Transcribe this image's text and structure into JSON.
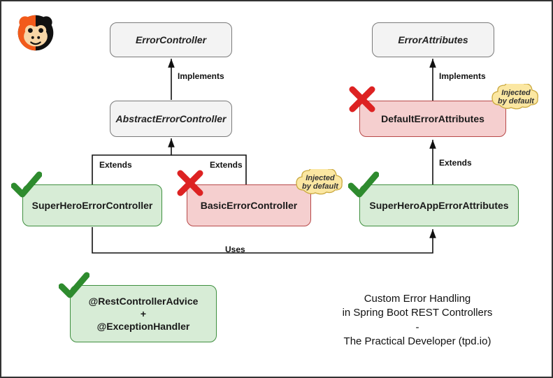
{
  "nodes": {
    "errorController": "ErrorController",
    "abstractErrorController": "AbstractErrorController",
    "superHeroErrorController": "SuperHeroErrorController",
    "basicErrorController": "BasicErrorController",
    "errorAttributes": "ErrorAttributes",
    "defaultErrorAttributes": "DefaultErrorAttributes",
    "superHeroAppErrorAttributes": "SuperHeroAppErrorAttributes",
    "adviceBox": "@RestControllerAdvice\n+\n@ExceptionHandler"
  },
  "edges": {
    "implements": "Implements",
    "extends": "Extends",
    "uses": "Uses"
  },
  "annotations": {
    "injectedByDefault": "Injected\nby default"
  },
  "caption": {
    "line1": "Custom Error Handling",
    "line2": "in Spring Boot REST Controllers",
    "line3": "-",
    "line4": "The Practical Developer (tpd.io)"
  }
}
